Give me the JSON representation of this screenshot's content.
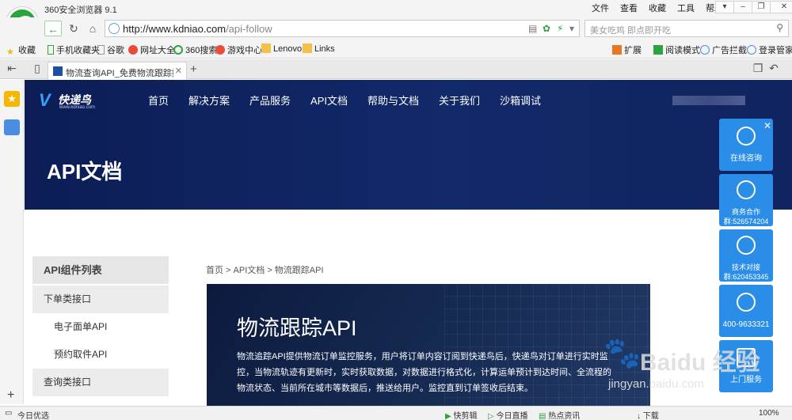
{
  "browser": {
    "app_title": "360安全浏览器 9.1",
    "menu": [
      "文件",
      "查看",
      "收藏",
      "工具",
      "帮助"
    ],
    "url_host": "http://www.kdniao.com",
    "url_path": "/api-follow",
    "search_placeholder": "美女吃鸡 即点即开吃",
    "favorites": [
      {
        "label": "收藏",
        "icon": "star-icon"
      },
      {
        "label": "手机收藏夹",
        "icon": "phone-icon"
      },
      {
        "label": "谷歌",
        "icon": "page-icon"
      },
      {
        "label": "网址大全",
        "icon": "globe-icon"
      },
      {
        "label": "360搜索",
        "icon": "search-360-icon"
      },
      {
        "label": "游戏中心",
        "icon": "game-icon"
      },
      {
        "label": "Lenovo",
        "icon": "folder-icon"
      },
      {
        "label": "Links",
        "icon": "folder-icon"
      }
    ],
    "fav_right": [
      "扩展",
      "阅读模式",
      "广告拦截",
      "登录管家"
    ],
    "tab_title": "物流查询API_免费物流跟踪接口-",
    "status": {
      "left": "今日优选",
      "items": [
        "快剪辑",
        "今日直播",
        "热点资讯",
        "下载"
      ],
      "zoom": "100%"
    }
  },
  "site": {
    "logo_text": "快递鸟",
    "logo_sub": "www.kdniao.com",
    "nav": [
      "首页",
      "解决方案",
      "产品服务",
      "API文档",
      "帮助与文档",
      "关于我们",
      "沙箱调试"
    ],
    "hero_title": "API文档",
    "side_menu": {
      "head": "API组件列表",
      "groups": [
        {
          "label": "下单类接口",
          "items": [
            "电子面单API",
            "预约取件API"
          ]
        },
        {
          "label": "查询类接口",
          "items": []
        }
      ]
    },
    "breadcrumb": "首页 > API文档 > 物流跟踪API",
    "doc_title": "物流跟踪API",
    "doc_desc": "物流追踪API提供物流订单监控服务，用户将订单内容订阅到快递鸟后，快递鸟对订单进行实时监控，当物流轨迹有更新时，实时获取数据，对数据进行格式化，计算运单预计到达时间、全流程的物流状态、当前所在城市等数据后，推送给用户。监控直到订单签收后结束。",
    "float": {
      "consult": "在线咨询",
      "business": "商务合作群:526574204",
      "tech": "技术对接群:620453345",
      "phone": "400-9633321",
      "service": "上门服务"
    }
  },
  "watermark": {
    "text": "Baidu 经验",
    "url": "jingyan.baidu.com"
  }
}
